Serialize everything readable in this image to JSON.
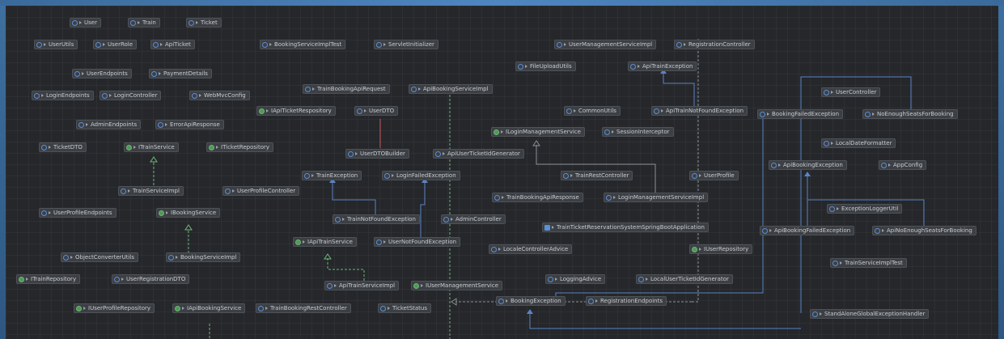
{
  "nodes": [
    {
      "id": "n1",
      "label": "User",
      "kind": "class"
    },
    {
      "id": "n2",
      "label": "Train",
      "kind": "class"
    },
    {
      "id": "n3",
      "label": "Ticket",
      "kind": "class"
    },
    {
      "id": "n4",
      "label": "UserUtils",
      "kind": "class"
    },
    {
      "id": "n5",
      "label": "UserRole",
      "kind": "class"
    },
    {
      "id": "n6",
      "label": "ApiTicket",
      "kind": "class"
    },
    {
      "id": "n7",
      "label": "BookingServiceImplTest",
      "kind": "class"
    },
    {
      "id": "n8",
      "label": "ServletInitializer",
      "kind": "class"
    },
    {
      "id": "n9",
      "label": "UserManagementServiceImpl",
      "kind": "class"
    },
    {
      "id": "n10",
      "label": "RegistrationController",
      "kind": "class"
    },
    {
      "id": "n11",
      "label": "FileUploadUtils",
      "kind": "class"
    },
    {
      "id": "n12",
      "label": "ApiTrainException",
      "kind": "class"
    },
    {
      "id": "n13",
      "label": "UserEndpoints",
      "kind": "class"
    },
    {
      "id": "n14",
      "label": "PaymentDetails",
      "kind": "class"
    },
    {
      "id": "n15",
      "label": "TrainBookingApiRequest",
      "kind": "class"
    },
    {
      "id": "n16",
      "label": "ApiBookingServiceImpl",
      "kind": "class"
    },
    {
      "id": "n17",
      "label": "UserController",
      "kind": "class"
    },
    {
      "id": "n18",
      "label": "LoginEndpoints",
      "kind": "class"
    },
    {
      "id": "n19",
      "label": "LoginController",
      "kind": "class"
    },
    {
      "id": "n20",
      "label": "WebMvcConfig",
      "kind": "class"
    },
    {
      "id": "n21",
      "label": "IApiTicketRespository",
      "kind": "iface"
    },
    {
      "id": "n22",
      "label": "UserDTO",
      "kind": "class"
    },
    {
      "id": "n23",
      "label": "CommonUtils",
      "kind": "class"
    },
    {
      "id": "n24",
      "label": "ApiTrainNotFoundException",
      "kind": "class"
    },
    {
      "id": "n25",
      "label": "BookingFailedException",
      "kind": "class"
    },
    {
      "id": "n26",
      "label": "NoEnoughSeatsForBooking",
      "kind": "class"
    },
    {
      "id": "n27",
      "label": "AdminEndpoints",
      "kind": "class"
    },
    {
      "id": "n28",
      "label": "ErrorApiResponse",
      "kind": "class"
    },
    {
      "id": "n29",
      "label": "ILoginManagementService",
      "kind": "iface"
    },
    {
      "id": "n30",
      "label": "SessionInterceptor",
      "kind": "class"
    },
    {
      "id": "n31",
      "label": "TicketDTO",
      "kind": "class"
    },
    {
      "id": "n32",
      "label": "ITrainService",
      "kind": "iface"
    },
    {
      "id": "n33",
      "label": "ITicketRepository",
      "kind": "iface"
    },
    {
      "id": "n34",
      "label": "UserDTOBuilder",
      "kind": "class"
    },
    {
      "id": "n35",
      "label": "ApiUserTicketIdGenerator",
      "kind": "class"
    },
    {
      "id": "n36",
      "label": "LocalDateFormatter",
      "kind": "class"
    },
    {
      "id": "n37",
      "label": "ApiBookingException",
      "kind": "class"
    },
    {
      "id": "n38",
      "label": "AppConfig",
      "kind": "class"
    },
    {
      "id": "n39",
      "label": "TrainException",
      "kind": "class"
    },
    {
      "id": "n40",
      "label": "LoginFailedException",
      "kind": "class"
    },
    {
      "id": "n41",
      "label": "TrainRestController",
      "kind": "class"
    },
    {
      "id": "n42",
      "label": "UserProfile",
      "kind": "class"
    },
    {
      "id": "n43",
      "label": "TrainServiceImpl",
      "kind": "class"
    },
    {
      "id": "n44",
      "label": "UserProfileController",
      "kind": "class"
    },
    {
      "id": "n45",
      "label": "TrainBookingApiResponse",
      "kind": "class"
    },
    {
      "id": "n46",
      "label": "LoginManagementServiceImpl",
      "kind": "class"
    },
    {
      "id": "n47",
      "label": "UserProfileEndpoints",
      "kind": "class"
    },
    {
      "id": "n48",
      "label": "IBookingService",
      "kind": "iface"
    },
    {
      "id": "n49",
      "label": "TrainNotFoundException",
      "kind": "class"
    },
    {
      "id": "n50",
      "label": "AdminController",
      "kind": "class"
    },
    {
      "id": "n51",
      "label": "ExceptionLoggerUtil",
      "kind": "class"
    },
    {
      "id": "n52",
      "label": "TrainTicketReservationSystemSpringBootApplication",
      "kind": "main"
    },
    {
      "id": "n53",
      "label": "ApiBookingFailedException",
      "kind": "class"
    },
    {
      "id": "n54",
      "label": "ApiNoEnoughSeatsForBooking",
      "kind": "class"
    },
    {
      "id": "n55",
      "label": "IApiTrainService",
      "kind": "iface"
    },
    {
      "id": "n56",
      "label": "UserNotFoundException",
      "kind": "class"
    },
    {
      "id": "n57",
      "label": "LocaleControllerAdvice",
      "kind": "class"
    },
    {
      "id": "n58",
      "label": "IUserRepository",
      "kind": "iface"
    },
    {
      "id": "n59",
      "label": "ObjectConverterUtils",
      "kind": "class"
    },
    {
      "id": "n60",
      "label": "BookingServiceImpl",
      "kind": "class"
    },
    {
      "id": "n61",
      "label": "TrainServiceImplTest",
      "kind": "class"
    },
    {
      "id": "n62",
      "label": "ITrainRepository",
      "kind": "iface"
    },
    {
      "id": "n63",
      "label": "UserRegistrationDTO",
      "kind": "class"
    },
    {
      "id": "n64",
      "label": "ApiTrainServiceImpl",
      "kind": "class"
    },
    {
      "id": "n65",
      "label": "IUserManagementService",
      "kind": "iface"
    },
    {
      "id": "n66",
      "label": "LoggingAdvice",
      "kind": "class"
    },
    {
      "id": "n67",
      "label": "LocalUserTicketIdGenerator",
      "kind": "class"
    },
    {
      "id": "n68",
      "label": "BookingException",
      "kind": "class"
    },
    {
      "id": "n69",
      "label": "RegistrationEndpoints",
      "kind": "class"
    },
    {
      "id": "n70",
      "label": "IUserProfileRepository",
      "kind": "iface"
    },
    {
      "id": "n71",
      "label": "IApiBookingService",
      "kind": "iface"
    },
    {
      "id": "n72",
      "label": "TrainBookingRestController",
      "kind": "class"
    },
    {
      "id": "n73",
      "label": "TicketStatus",
      "kind": "class"
    },
    {
      "id": "n74",
      "label": "StandAloneGlobalExceptionHandler",
      "kind": "class"
    }
  ]
}
